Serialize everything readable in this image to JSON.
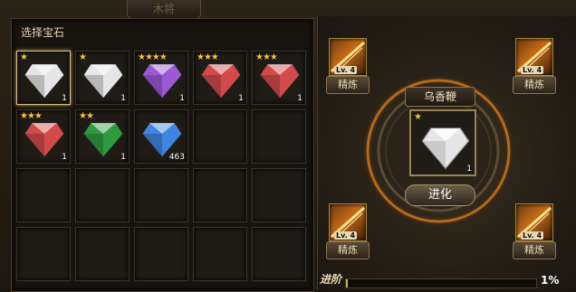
{
  "top_tab": "木将",
  "left_panel": {
    "title": "选择宝石",
    "slots": [
      {
        "stars": "★",
        "count": "1",
        "gem": "white",
        "selected": true
      },
      {
        "stars": "★",
        "count": "1",
        "gem": "white"
      },
      {
        "stars": "★★★★",
        "count": "1",
        "gem": "purple"
      },
      {
        "stars": "★★★",
        "count": "1",
        "gem": "red"
      },
      {
        "stars": "★★★",
        "count": "1",
        "gem": "red"
      },
      {
        "stars": "★★★",
        "count": "1",
        "gem": "red"
      },
      {
        "stars": "★★",
        "count": "1",
        "gem": "green"
      },
      {
        "stars": "",
        "count": "463",
        "gem": "blue"
      }
    ]
  },
  "right_panel": {
    "weapon_name": "乌香鞭",
    "center_gem": {
      "stars": "★",
      "count": "1",
      "gem": "white"
    },
    "evolve_label": "进化",
    "skills": [
      {
        "level": "Lv. 4",
        "button": "精炼"
      },
      {
        "level": "Lv. 4",
        "button": "精炼"
      },
      {
        "level": "Lv. 4",
        "button": "精炼"
      },
      {
        "level": "Lv. 4",
        "button": "精炼"
      }
    ],
    "progress_label": "进阶",
    "progress_value": 0.01,
    "progress_text": "1%"
  },
  "colors": {
    "white": "#e6e6e6",
    "purple": "#9b59d6",
    "red": "#d24a4a",
    "green": "#2f9b3f",
    "blue": "#3f86e0",
    "accent": "#c9a95a"
  }
}
